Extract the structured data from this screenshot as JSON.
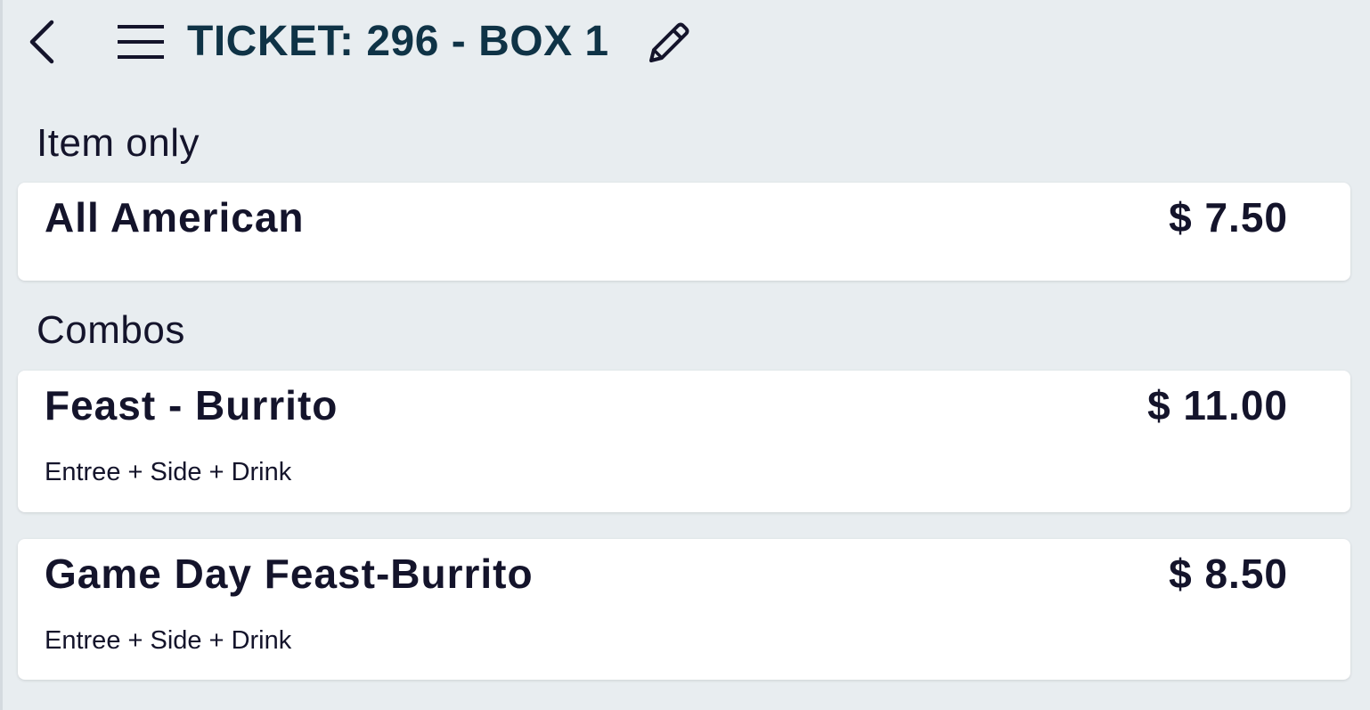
{
  "header": {
    "back_icon": "chevron-left-icon",
    "menu_icon": "hamburger-menu-icon",
    "title": "TICKET: 296 - BOX 1",
    "edit_icon": "pencil-icon",
    "title_color": "#0f3346"
  },
  "sections": [
    {
      "title": "Item only",
      "items": [
        {
          "name": "All American",
          "price": "$ 7.50",
          "description": ""
        }
      ]
    },
    {
      "title": "Combos",
      "items": [
        {
          "name": "Feast - Burrito",
          "price": "$ 11.00",
          "description": "Entree + Side + Drink"
        },
        {
          "name": "Game Day Feast-Burrito",
          "price": "$ 8.50",
          "description": "Entree + Side + Drink"
        }
      ]
    }
  ],
  "colors": {
    "background": "#e8edf0",
    "card": "#ffffff",
    "text": "#14142b"
  }
}
